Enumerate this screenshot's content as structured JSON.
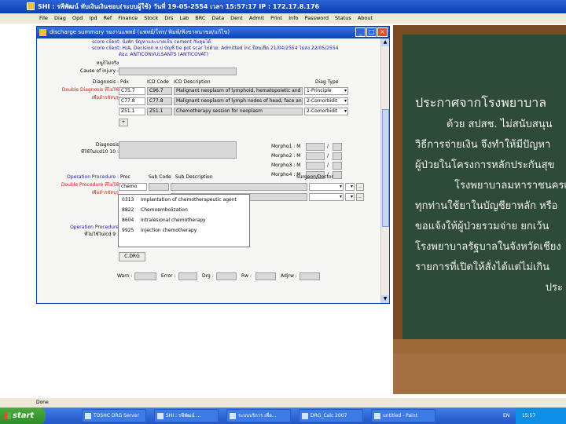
{
  "app": {
    "title": "SHI : รพีพัฒน์ ทับเงินเงินชอบ(ระบบผู้ใช้) วันที่ 19-05-2554 เวลา 15:57:17 IP : 172.17.8.176"
  },
  "menu": [
    "File",
    "Diag",
    "Opd",
    "Ipd",
    "Ref",
    "Finance",
    "Stock",
    "Drs",
    "Lab",
    "BRC",
    "Data",
    "Dent",
    "Admit",
    "Print",
    "Info",
    "Password",
    "Status",
    "About"
  ],
  "dialog": {
    "title": "discharge summary  รยงานแพทย์ (แพทย์/โทร/ พิมพ์/ฟ้งขาหนาขส/แก้ไข)",
    "top_lines": [
      "score client: นั่งพัก ปัญหาและบาดเจ็บ cement กับคุมได้",
      "score client: H/A, Decision ท.ป บัญชี tie pot scar ไปด้วย. Admitted inc.ปีสม/ยืด 21/04/2554 ไม่ส่ง 22/05/2554",
      "ต้อง: ANTICONVULSANTS (ANTICOVAT)"
    ],
    "neighbour_label": "หนูก็ไม่จริง",
    "cause_label": "Cause of injury :",
    "diagnosis": {
      "label": "Diagnosis :",
      "red_label_1": "Double Diagnosis ที่ไม่ใช้",
      "red_label_2": "เพื่อลำรหัสบุรุ",
      "headers": [
        "Pdx",
        "ICD Code",
        "ICD Description",
        "Diag Type"
      ],
      "rows": [
        {
          "code": "C75.7",
          "icd": "C96.7",
          "desc": "Malignant neoplasm of lymphoid, hematopoietic and related tissue",
          "type": "1-Principle"
        },
        {
          "code": "C77.8",
          "icd": "C77.8",
          "desc": "Malignant neoplasm of lymph nodes of head, face and neck",
          "type": "2-Comorbidit"
        },
        {
          "code": "Z51.1",
          "icd": "Z51.1",
          "desc": "Chemotherapy session for neoplasm",
          "type": "2-Comorbidit"
        }
      ],
      "plus": "+"
    },
    "diagnosis2": {
      "label": "Diagnosis",
      "label2": "ที่ใช้ในIcd10 10 :"
    },
    "morpho": [
      {
        "label": "Morpho1 : M",
        "sep": "/"
      },
      {
        "label": "Morpho2 : M",
        "sep": "/"
      },
      {
        "label": "Morpho3 : M",
        "sep": "/"
      },
      {
        "label": "Morpho4 : M",
        "sep": "/"
      }
    ],
    "operation": {
      "label": "Operation Procedure :",
      "red_label_1": "Double Procedure ที่ไม่ใช้",
      "red_label_2": "เพื่อลำรหัสบุรุ",
      "headers": [
        "Proc",
        "Sub Code",
        "Sub Description",
        "Surgeon/Doctor"
      ],
      "input_value": "chemo",
      "dots": [
        "..",
        ".."
      ]
    },
    "operation2": {
      "label": "Operation Procedure",
      "label2": "ที่ไม่ใช้ในIcd 9 :"
    },
    "dropdown": [
      {
        "code": "0313",
        "text": "Implantation of chemotherapeutic agent"
      },
      {
        "code": "8822",
        "text": "Chemoembolization"
      },
      {
        "code": "8604",
        "text": "Intralesional chemotherapy"
      },
      {
        "code": "9925",
        "text": "Injection chemotherapy"
      }
    ],
    "chg_button": "C.DRG",
    "bottom": [
      {
        "label": "Warn :"
      },
      {
        "label": "Error :"
      },
      {
        "label": "Drg :"
      },
      {
        "label": "Rw :"
      },
      {
        "label": "Adjrw :"
      }
    ]
  },
  "board": {
    "lines": [
      "ประกาศจากโรงพยาบาล",
      "ด้วย สปสช. ไม่สนับสนุน",
      "วิธีการจ่ายเงิน จึงทำให้มีปัญหา",
      "ผู้ป่วยในโครงการหลักประกันสุข",
      "โรงพยาบาลมหาราชนครเชียง",
      "ทุกท่านใช้ยาในบัญชียาหลัก หรือ",
      "ขอแจ้งให้ผู้ป่วยรวมจ่าย ยกเว้น",
      "โรงพยาบาลรัฐบาลในจังหวัดเชียง",
      "รายการที่เปิดให้สั่งได้แต่ไม่เกิน",
      "ประ"
    ]
  },
  "status": {
    "text": "Done"
  },
  "taskbar": {
    "start": "start",
    "items": [
      "TOSHC DRG Server",
      "SHI : รพีพัฒน์ ...",
      "ระบบบริการ เพื่อ...",
      "DRG_Calc 2007",
      "untitled - Paint"
    ],
    "lang": "EN",
    "time": "15:57"
  }
}
